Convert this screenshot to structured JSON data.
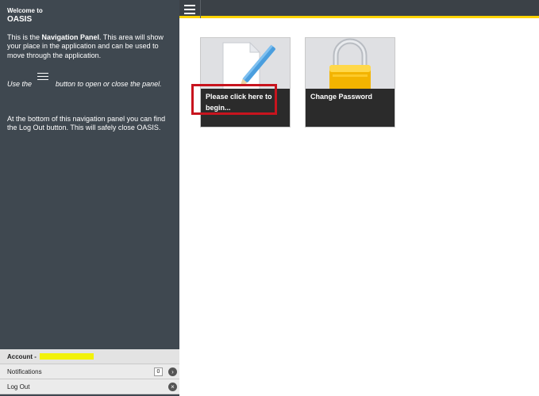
{
  "sidebar": {
    "welcome": "Welcome to",
    "app_name": "OASIS",
    "intro_prefix": "This is the ",
    "intro_bold": "Navigation Panel",
    "intro_suffix": ". This area will show your place in the application and can be used to move through the application.",
    "use_prefix": "Use the",
    "use_suffix": "button to open or close the panel.",
    "bottom_note": "At the bottom of this navigation panel you can find the Log Out button. This will safely close OASIS.",
    "footer": {
      "account_label": "Account -",
      "account_value": "redacted",
      "notifications_label": "Notifications",
      "notifications_count": "0",
      "logout_label": "Log Out"
    }
  },
  "tiles": [
    {
      "label": "Please click here to begin...",
      "icon": "document-pen-icon"
    },
    {
      "label": "Change Password",
      "icon": "padlock-icon"
    }
  ],
  "colors": {
    "sidebar_bg": "#3f4850",
    "topbar_bg": "#3b4147",
    "accent": "#ffd400",
    "highlight": "#c8141e",
    "account_highlight": "#f2f20a"
  }
}
